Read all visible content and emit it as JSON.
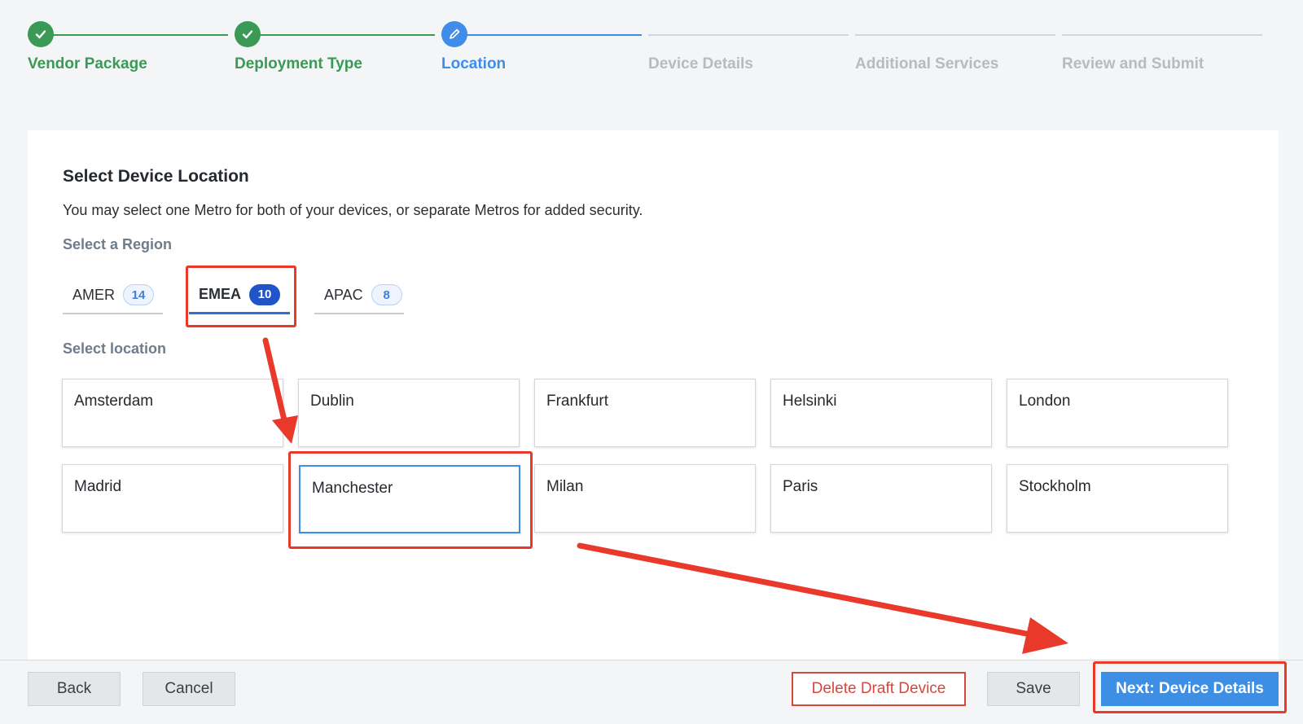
{
  "stepper": {
    "steps": [
      {
        "label": "Vendor Package",
        "state": "done"
      },
      {
        "label": "Deployment Type",
        "state": "done"
      },
      {
        "label": "Location",
        "state": "active"
      },
      {
        "label": "Device Details",
        "state": "pending"
      },
      {
        "label": "Additional Services",
        "state": "pending"
      },
      {
        "label": "Review and Submit",
        "state": "pending"
      }
    ]
  },
  "location": {
    "title": "Select Device Location",
    "description": "You may select one Metro for both of your devices, or separate Metros for added security.",
    "region_label": "Select a Region",
    "regions": [
      {
        "name": "AMER",
        "count": "14",
        "selected": false
      },
      {
        "name": "EMEA",
        "count": "10",
        "selected": true
      },
      {
        "name": "APAC",
        "count": "8",
        "selected": false
      }
    ],
    "location_label": "Select location",
    "locations": [
      "Amsterdam",
      "Dublin",
      "Frankfurt",
      "Helsinki",
      "London",
      "Madrid",
      "Manchester",
      "Milan",
      "Paris",
      "Stockholm"
    ],
    "selected_location": "Manchester"
  },
  "footer": {
    "back_label": "Back",
    "cancel_label": "Cancel",
    "delete_label": "Delete Draft Device",
    "save_label": "Save",
    "next_label": "Next: Device Details"
  },
  "colors": {
    "done": "#3a9a55",
    "active": "#3f8de8",
    "annotation": "#e8392b"
  }
}
